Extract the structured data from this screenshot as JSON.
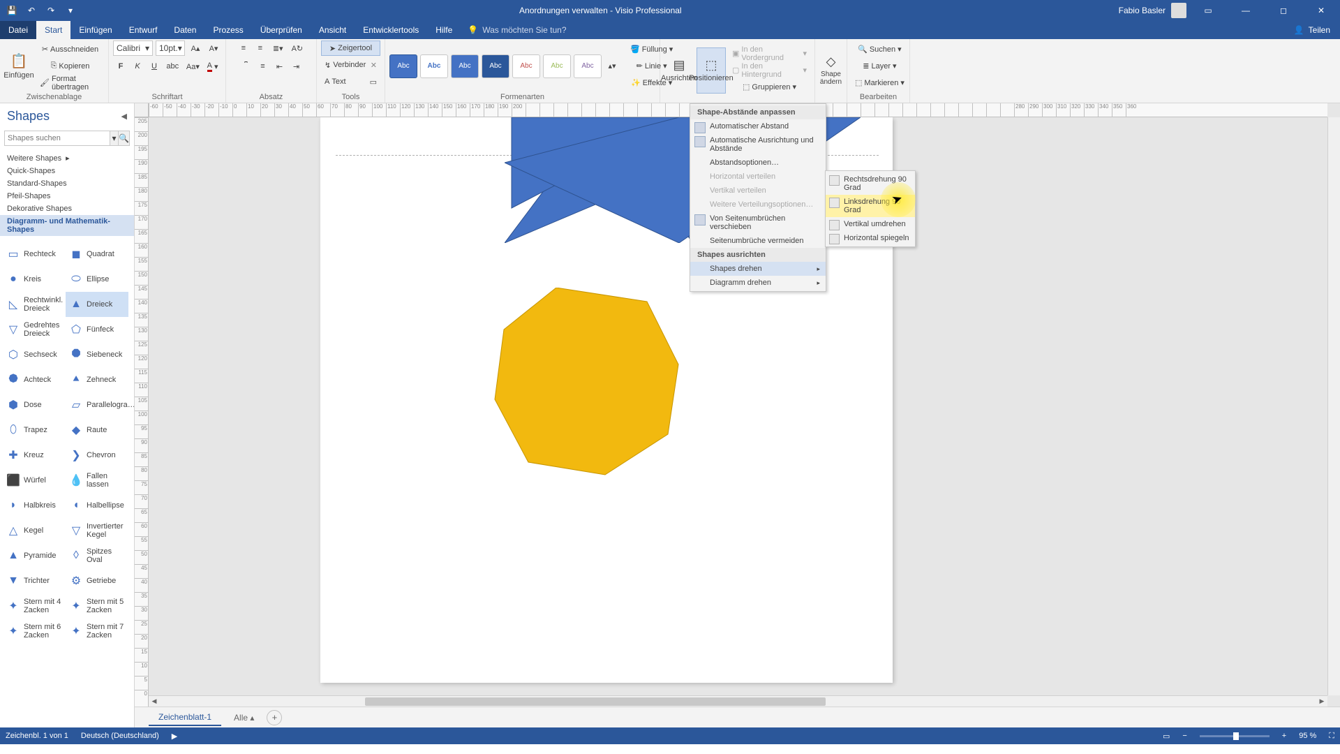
{
  "titlebar": {
    "title": "Anordnungen verwalten - Visio Professional",
    "user": "Fabio Basler"
  },
  "tabs": {
    "file": "Datei",
    "items": [
      "Start",
      "Einfügen",
      "Entwurf",
      "Daten",
      "Prozess",
      "Überprüfen",
      "Ansicht",
      "Entwicklertools",
      "Hilfe"
    ],
    "tellme": "Was möchten Sie tun?",
    "share": "Teilen"
  },
  "ribbon": {
    "clipboard": {
      "paste": "Einfügen",
      "cut": "Ausschneiden",
      "copy": "Kopieren",
      "formatpainter": "Format übertragen",
      "label": "Zwischenablage"
    },
    "font": {
      "name": "Calibri",
      "size": "10pt.",
      "label": "Schriftart"
    },
    "paragraph": {
      "label": "Absatz"
    },
    "tools": {
      "pointer": "Zeigertool",
      "connector": "Verbinder",
      "text": "Text",
      "label": "Tools"
    },
    "styles": {
      "abc": "Abc",
      "label": "Formenarten",
      "fill": "Füllung",
      "line": "Linie",
      "effects": "Effekte"
    },
    "arrange": {
      "align": "Ausrichten",
      "position": "Positionieren",
      "front": "In den Vordergrund",
      "back": "In den Hintergrund",
      "group": "Gruppieren"
    },
    "shapechange": {
      "label": "Shape ändern"
    },
    "edit": {
      "find": "Suchen",
      "layer": "Layer",
      "select": "Markieren",
      "label": "Bearbeiten"
    }
  },
  "dropdown": {
    "sec1": "Shape-Abstände anpassen",
    "autospace": "Automatischer Abstand",
    "autoalign": "Automatische Ausrichtung und Abstände",
    "spaceopts": "Abstandsoptionen…",
    "hdistrib": "Horizontal verteilen",
    "vdistrib": "Vertikal verteilen",
    "moredistrib": "Weitere Verteilungsoptionen…",
    "movebreaks": "Von Seitenumbrüchen verschieben",
    "avoidbreaks": "Seitenumbrüche vermeiden",
    "sec2": "Shapes ausrichten",
    "rotshapes": "Shapes drehen",
    "rotdiagram": "Diagramm drehen"
  },
  "submenu": {
    "right90": "Rechtsdrehung 90 Grad",
    "left90": "Linksdrehung 90 Grad",
    "flipv": "Vertikal umdrehen",
    "fliph": "Horizontal spiegeln"
  },
  "shapes_panel": {
    "title": "Shapes",
    "search_ph": "Shapes suchen",
    "more": "Weitere Shapes",
    "stencils": [
      "Quick-Shapes",
      "Standard-Shapes",
      "Pfeil-Shapes",
      "Dekorative Shapes",
      "Diagramm- und Mathematik-Shapes"
    ],
    "shapes": [
      [
        "Rechteck",
        "Quadrat"
      ],
      [
        "Kreis",
        "Ellipse"
      ],
      [
        "Rechtwinkl. Dreieck",
        "Dreieck"
      ],
      [
        "Gedrehtes Dreieck",
        "Fünfeck"
      ],
      [
        "Sechseck",
        "Siebeneck"
      ],
      [
        "Achteck",
        "Zehneck"
      ],
      [
        "Dose",
        "Parallelogra…"
      ],
      [
        "Trapez",
        "Raute"
      ],
      [
        "Kreuz",
        "Chevron"
      ],
      [
        "Würfel",
        "Fallen lassen"
      ],
      [
        "Halbkreis",
        "Halbellipse"
      ],
      [
        "Kegel",
        "Invertierter Kegel"
      ],
      [
        "Pyramide",
        "Spitzes Oval"
      ],
      [
        "Trichter",
        "Getriebe"
      ],
      [
        "Stern mit 4 Zacken",
        "Stern mit 5 Zacken"
      ],
      [
        "Stern mit 6 Zacken",
        "Stern mit 7 Zacken"
      ]
    ]
  },
  "ruler_h": [
    "-60",
    "-50",
    "-40",
    "-30",
    "-20",
    "-10",
    "0",
    "10",
    "20",
    "30",
    "40",
    "50",
    "60",
    "70",
    "80",
    "90",
    "100",
    "110",
    "120",
    "130",
    "140",
    "150",
    "160",
    "170",
    "180",
    "190",
    "200",
    "",
    "",
    "",
    "",
    "",
    "",
    "",
    "",
    "",
    "",
    "",
    "",
    "",
    "",
    "",
    "",
    "",
    "",
    "",
    "",
    "",
    "",
    "",
    "",
    "",
    "",
    "",
    "",
    "",
    "",
    "",
    "",
    "",
    "",
    "",
    "280",
    "290",
    "300",
    "310",
    "320",
    "330",
    "340",
    "350",
    "360"
  ],
  "ruler_v": [
    "205",
    "200",
    "195",
    "190",
    "185",
    "180",
    "175",
    "170",
    "165",
    "160",
    "155",
    "150",
    "145",
    "140",
    "135",
    "130",
    "125",
    "120",
    "115",
    "110",
    "105",
    "100",
    "95",
    "90",
    "85",
    "80",
    "75",
    "70",
    "65",
    "60",
    "55",
    "50",
    "45",
    "40",
    "35",
    "30",
    "25",
    "20",
    "15",
    "10",
    "5",
    "0"
  ],
  "sheets": {
    "tab": "Zeichenblatt-1",
    "all": "Alle"
  },
  "status": {
    "page": "Zeichenbl. 1 von 1",
    "lang": "Deutsch (Deutschland)",
    "zoom": "95 %"
  }
}
